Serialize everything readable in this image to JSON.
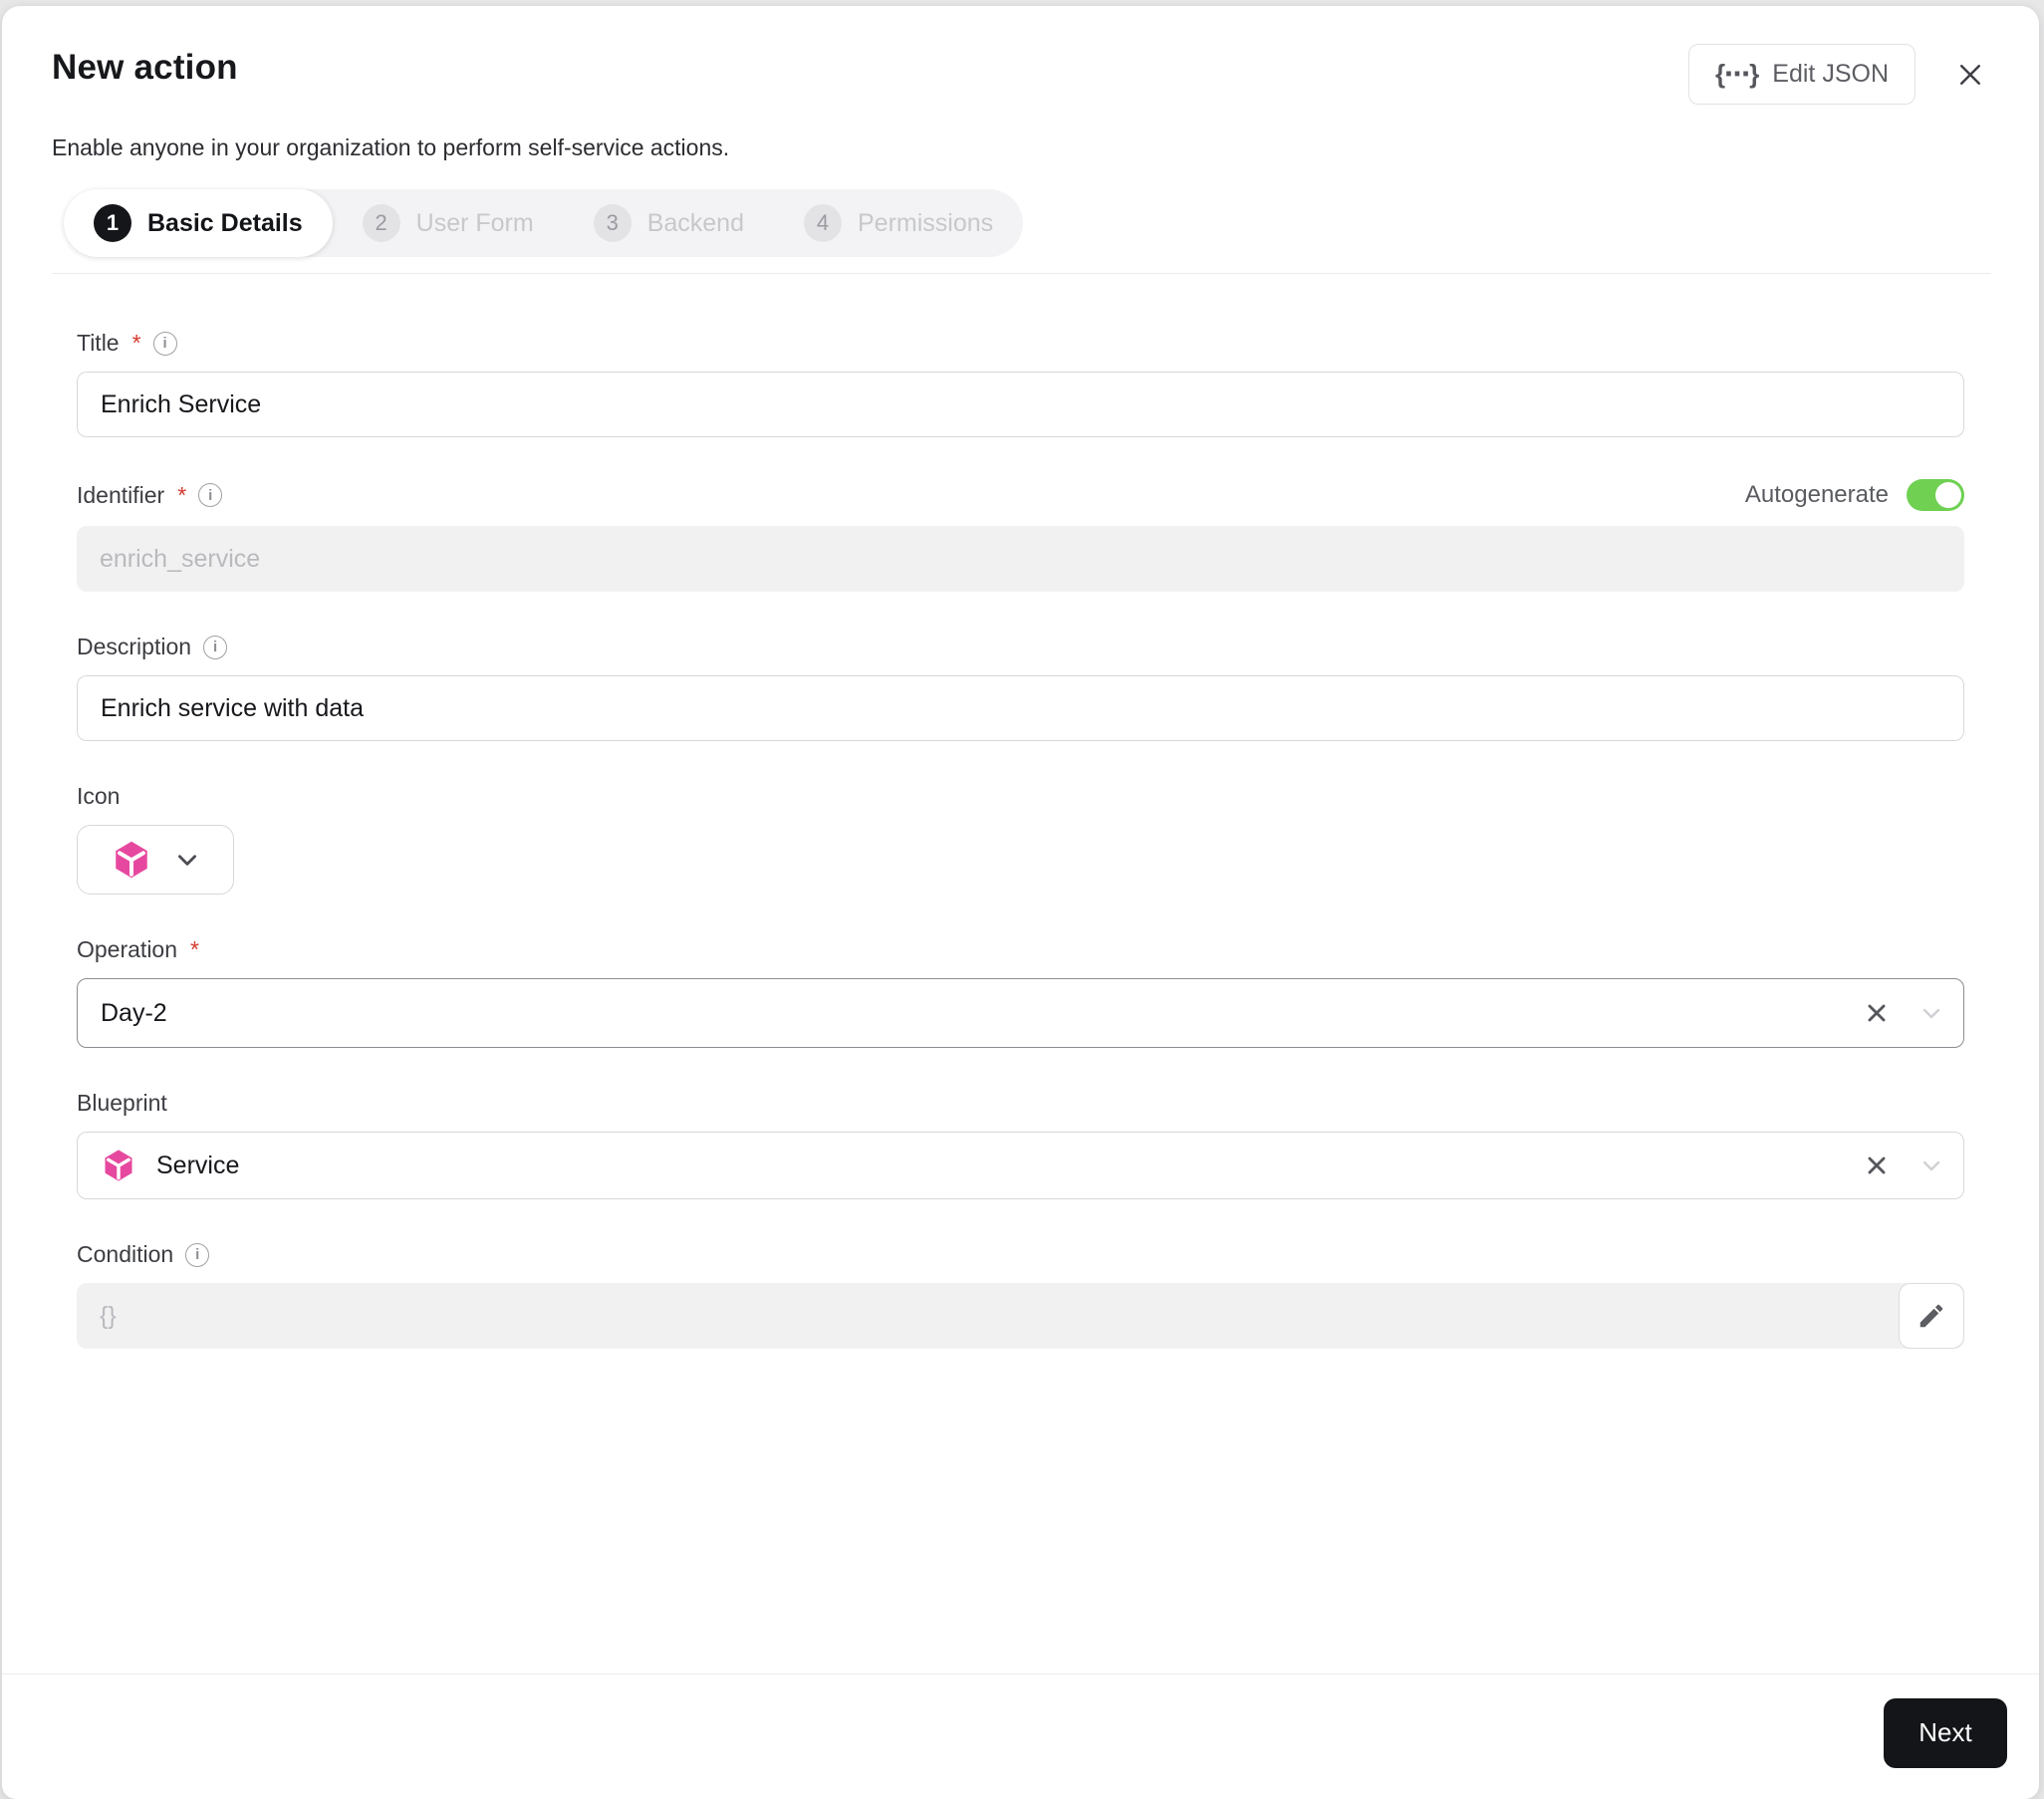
{
  "header": {
    "title": "New action",
    "subtitle": "Enable anyone in your organization to perform self-service actions.",
    "edit_json_label": "Edit JSON",
    "braces_glyph": "{⋯}"
  },
  "stepper": {
    "steps": [
      {
        "number": "1",
        "label": "Basic Details"
      },
      {
        "number": "2",
        "label": "User Form"
      },
      {
        "number": "3",
        "label": "Backend"
      },
      {
        "number": "4",
        "label": "Permissions"
      }
    ],
    "active_step": "1"
  },
  "form": {
    "title": {
      "label": "Title",
      "required": "*",
      "value": "Enrich Service"
    },
    "identifier": {
      "label": "Identifier",
      "required": "*",
      "value": "enrich_service",
      "autogenerate_label": "Autogenerate",
      "autogenerate_state": "on"
    },
    "description": {
      "label": "Description",
      "value": "Enrich service with data"
    },
    "icon": {
      "label": "Icon",
      "selected_icon": "pink-cube"
    },
    "operation": {
      "label": "Operation",
      "required": "*",
      "value": "Day-2"
    },
    "blueprint": {
      "label": "Blueprint",
      "value": "Service",
      "icon": "pink-cube"
    },
    "condition": {
      "label": "Condition",
      "value": "{}"
    }
  },
  "footer": {
    "next_label": "Next"
  },
  "colors": {
    "accent_pink": "#e7489f",
    "toggle_green": "#6fd052",
    "button_black": "#141519",
    "step_active": "#151619"
  }
}
